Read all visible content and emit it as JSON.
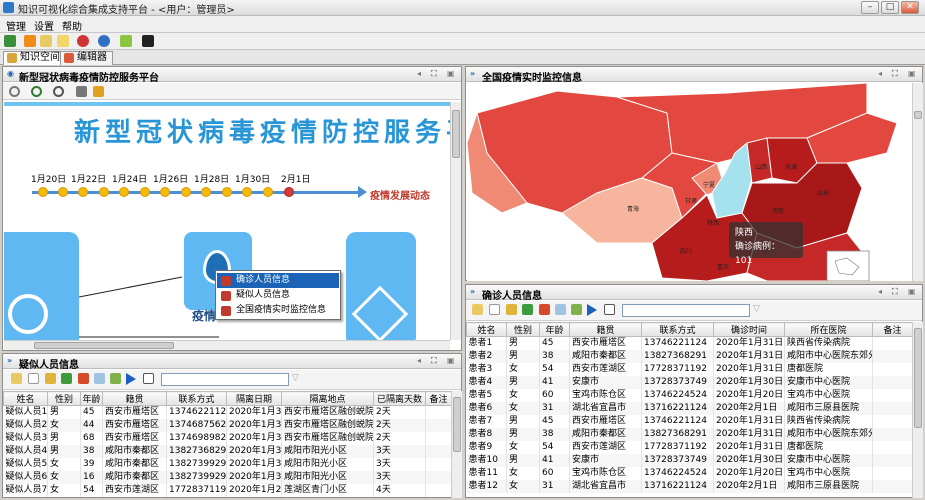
{
  "window": {
    "title": "知识可视化综合集成支持平台 - <用户：管理员>",
    "min": "–",
    "max": "□",
    "close": "✕"
  },
  "menu": [
    "管理",
    "设置",
    "帮助"
  ],
  "tabs": [
    {
      "label": "知识空间",
      "icon": "puzzle-icon"
    },
    {
      "label": "编辑器",
      "icon": "edit-icon"
    }
  ],
  "left_panel": {
    "title": "新型冠状病毒疫情防控服务平台",
    "banner_title": "新型冠状病毒疫情防控服务平",
    "timeline_dates": [
      "1月20日",
      "1月22日",
      "1月24日",
      "1月26日",
      "1月28日",
      "1月30日",
      "2月1日"
    ],
    "timeline_label": "疫情发展动态",
    "node_caption": "疫情",
    "context_menu": [
      "确诊人员信息",
      "疑似人员信息",
      "全国疫情实时监控信息"
    ]
  },
  "map_panel": {
    "title": "全国疫情实时监控信息",
    "tooltip_province": "陕西",
    "tooltip_text": "确诊病例：101",
    "labels": [
      "宁夏",
      "甘肃",
      "青海",
      "陕西",
      "河南",
      "山西",
      "天津",
      "四川",
      "湖北",
      "重庆",
      "山东"
    ],
    "colors": {
      "dark": "#b71c1c",
      "mid": "#e2483f",
      "light": "#f08a74",
      "pale": "#f7b59e",
      "cyan": "#a6e1ee"
    }
  },
  "confirmed_panel": {
    "title": "确诊人员信息",
    "columns": [
      "姓名",
      "性别",
      "年龄",
      "籍贯",
      "联系方式",
      "确诊时间",
      "所在医院",
      "备注"
    ],
    "rows": [
      [
        "患者1",
        "男",
        "45",
        "西安市雁塔区",
        "13746221124",
        "2020年1月31日",
        "陕西省传染病院",
        ""
      ],
      [
        "患者2",
        "男",
        "38",
        "咸阳市秦都区",
        "13827368291",
        "2020年1月31日",
        "咸阳市中心医院东郊分院",
        ""
      ],
      [
        "患者3",
        "女",
        "54",
        "西安市莲湖区",
        "17728371192",
        "2020年1月31日",
        "唐都医院",
        ""
      ],
      [
        "患者4",
        "男",
        "41",
        "安康市",
        "13728373749",
        "2020年1月30日",
        "安康市中心医院",
        ""
      ],
      [
        "患者5",
        "女",
        "60",
        "宝鸡市陈仓区",
        "13746224524",
        "2020年1月20日",
        "宝鸡市中心医院",
        ""
      ],
      [
        "患者6",
        "女",
        "31",
        "湖北省宜昌市",
        "13716221124",
        "2020年2月1日",
        "咸阳市三原县医院",
        ""
      ],
      [
        "患者7",
        "男",
        "45",
        "西安市雁塔区",
        "13746221124",
        "2020年1月31日",
        "陕西省传染病院",
        ""
      ],
      [
        "患者8",
        "男",
        "38",
        "咸阳市秦都区",
        "13827368291",
        "2020年1月31日",
        "咸阳市中心医院东郊分院",
        ""
      ],
      [
        "患者9",
        "女",
        "54",
        "西安市莲湖区",
        "17728371192",
        "2020年1月31日",
        "唐都医院",
        ""
      ],
      [
        "患者10",
        "男",
        "41",
        "安康市",
        "13728373749",
        "2020年1月30日",
        "安康市中心医院",
        ""
      ],
      [
        "患者11",
        "女",
        "60",
        "宝鸡市陈仓区",
        "13746224524",
        "2020年1月20日",
        "宝鸡市中心医院",
        ""
      ],
      [
        "患者12",
        "女",
        "31",
        "湖北省宜昌市",
        "13716221124",
        "2020年2月1日",
        "咸阳市三原县医院",
        ""
      ]
    ]
  },
  "suspected_panel": {
    "title": "疑似人员信息",
    "columns": [
      "姓名",
      "性别",
      "年龄",
      "籍贯",
      "联系方式",
      "隔离日期",
      "隔离地点",
      "已隔离天数",
      "备注"
    ],
    "rows": [
      [
        "疑似人员1",
        "男",
        "45",
        "西安市雁塔区",
        "13746221124",
        "2020年1月31日",
        "西安市雁塔区融创蜕院府",
        "2天",
        ""
      ],
      [
        "疑似人员2",
        "女",
        "44",
        "西安市雁塔区",
        "13746875624",
        "2020年1月31日",
        "西安市雁塔区融创蜕院府",
        "2天",
        ""
      ],
      [
        "疑似人员3",
        "男",
        "68",
        "西安市雁塔区",
        "13746989824",
        "2020年1月31日",
        "西安市雁塔区融创蜕院府",
        "2天",
        ""
      ],
      [
        "疑似人员4",
        "男",
        "38",
        "咸阳市秦都区",
        "13827368291",
        "2020年1月30日",
        "咸阳市阳光小区",
        "3天",
        ""
      ],
      [
        "疑似人员5",
        "女",
        "39",
        "咸阳市秦都区",
        "13827399291",
        "2020年1月30日",
        "咸阳市阳光小区",
        "3天",
        ""
      ],
      [
        "疑似人员6",
        "女",
        "16",
        "咸阳市秦都区",
        "13827399291",
        "2020年1月30日",
        "咸阳市阳光小区",
        "3天",
        ""
      ],
      [
        "疑似人员7",
        "女",
        "54",
        "西安市莲湖区",
        "17728371192",
        "2020年1月29日",
        "莲湖区青门小区",
        "4天",
        ""
      ]
    ]
  }
}
